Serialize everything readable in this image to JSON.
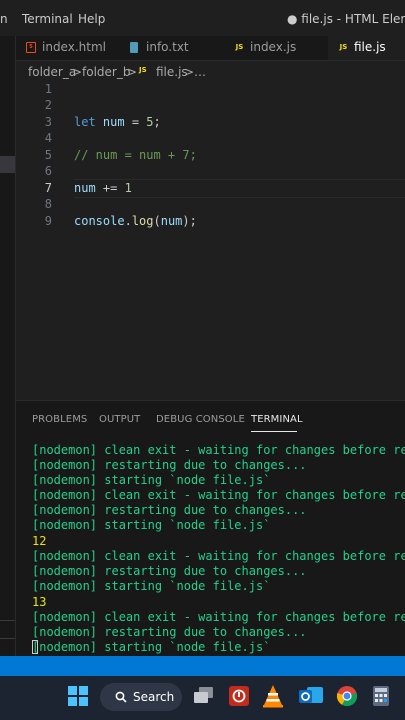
{
  "menu": {
    "partial_left": "n",
    "terminal": "Terminal",
    "help": "Help",
    "title": "● file.js - HTML Elements"
  },
  "tabs": [
    {
      "label": "index.html",
      "icon": "html-file-icon"
    },
    {
      "label": "info.txt",
      "icon": "text-file-icon"
    },
    {
      "label": "index.js",
      "icon": "js-file-icon"
    },
    {
      "label": "file.js",
      "icon": "js-file-icon",
      "active": true
    }
  ],
  "breadcrumb": {
    "folder_a": "folder_a",
    "sep": ">",
    "folder_b": "folder_b",
    "file": "file.js",
    "more": "…"
  },
  "editor": {
    "line_numbers": [
      "1",
      "2",
      "3",
      "4",
      "5",
      "6",
      "7",
      "8",
      "9"
    ],
    "current_line": "7",
    "lines": [
      "",
      "",
      "let num = 5;",
      "",
      "// num = num + 7;",
      "",
      "num += 1",
      "",
      "console.log(num);"
    ]
  },
  "panel": {
    "tabs": [
      "PROBLEMS",
      "OUTPUT",
      "DEBUG CONSOLE",
      "TERMINAL"
    ],
    "active_tab": "TERMINAL",
    "terminal_lines": [
      "[nodemon] clean exit - waiting for changes before restart",
      "[nodemon] restarting due to changes...",
      "[nodemon] starting `node file.js`",
      "[nodemon] clean exit - waiting for changes before restart",
      "[nodemon] restarting due to changes...",
      "[nodemon] starting `node file.js`",
      "12",
      "[nodemon] clean exit - waiting for changes before restart",
      "[nodemon] restarting due to changes...",
      "[nodemon] starting `node file.js`",
      "13",
      "[nodemon] clean exit - waiting for changes before restart",
      "[nodemon] restarting due to changes...",
      "[nodemon] starting `node file.js`"
    ]
  },
  "taskbar": {
    "search_label": "Search"
  },
  "colors": {
    "status_bar": "#0078d4",
    "terminal_text": "#23d18b",
    "output_text": "#e5e510",
    "keyword": "#569cd6"
  }
}
